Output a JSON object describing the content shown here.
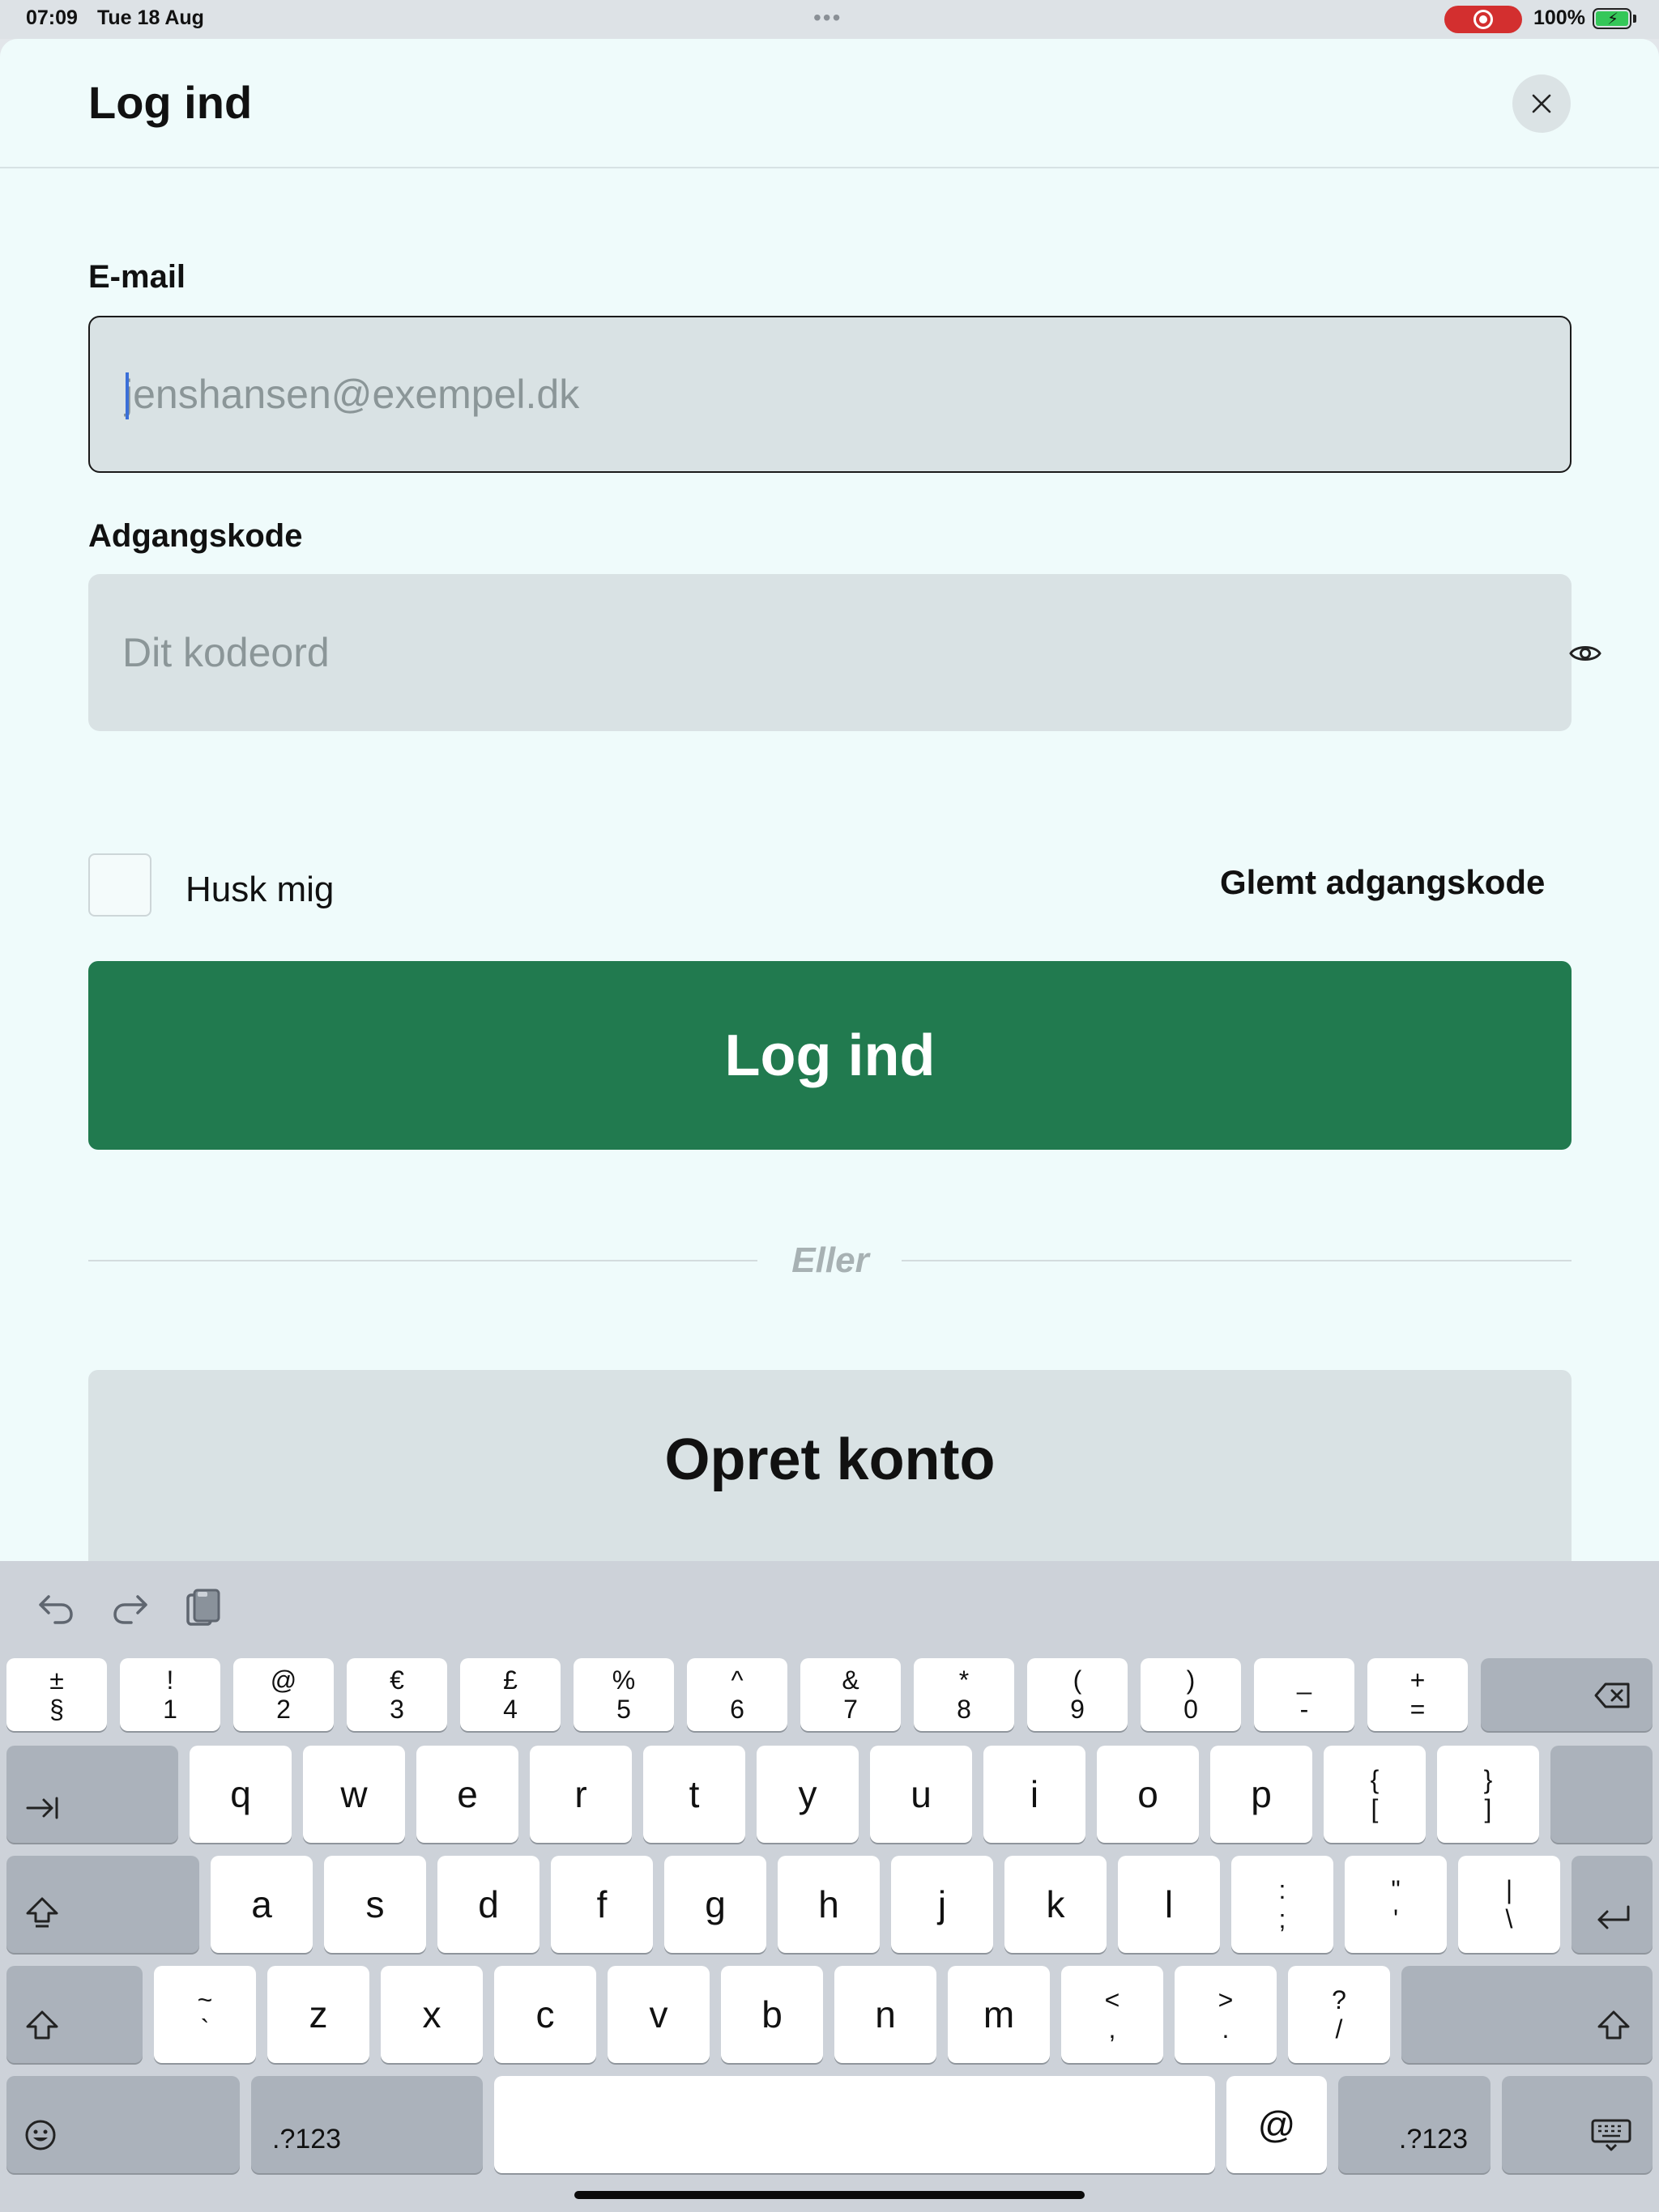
{
  "status_bar": {
    "time": "07:09",
    "date": "Tue 18 Aug",
    "battery_percent": "100%",
    "battery_charging": true,
    "recording_indicator": true
  },
  "sheet": {
    "title": "Log ind",
    "close_icon": "close-icon"
  },
  "form": {
    "email_label": "E-mail",
    "email_placeholder": "jenshansen@exempel.dk",
    "email_value": "",
    "password_label": "Adgangskode",
    "password_placeholder": "Dit kodeord",
    "password_value": "",
    "show_password_icon": "eye-icon",
    "remember_label": "Husk mig",
    "remember_checked": false,
    "forgot_link": "Glemt adgangskode",
    "login_button": "Log ind",
    "divider_text": "Eller",
    "create_account_button": "Opret konto"
  },
  "colors": {
    "primary_green": "#217a4f",
    "sheet_background": "#effbfb",
    "field_background": "#d9e2e4"
  },
  "keyboard": {
    "toolbar_icons": [
      "undo-icon",
      "redo-icon",
      "paste-icon"
    ],
    "number_row": [
      {
        "top": "±",
        "bottom": "§"
      },
      {
        "top": "!",
        "bottom": "1"
      },
      {
        "top": "@",
        "bottom": "2"
      },
      {
        "top": "€",
        "bottom": "3"
      },
      {
        "top": "£",
        "bottom": "4"
      },
      {
        "top": "%",
        "bottom": "5"
      },
      {
        "top": "^",
        "bottom": "6"
      },
      {
        "top": "&",
        "bottom": "7"
      },
      {
        "top": "*",
        "bottom": "8"
      },
      {
        "top": "(",
        "bottom": "9"
      },
      {
        "top": ")",
        "bottom": "0"
      },
      {
        "top": "_",
        "bottom": "-"
      },
      {
        "top": "+",
        "bottom": "="
      }
    ],
    "row_q": [
      "q",
      "w",
      "e",
      "r",
      "t",
      "y",
      "u",
      "i",
      "o",
      "p"
    ],
    "row_q_symbols": [
      {
        "top": "{",
        "bottom": "["
      },
      {
        "top": "}",
        "bottom": "]"
      }
    ],
    "row_a": [
      "a",
      "s",
      "d",
      "f",
      "g",
      "h",
      "j",
      "k",
      "l"
    ],
    "row_a_symbols": [
      {
        "top": ":",
        "bottom": ";"
      },
      {
        "top": "\"",
        "bottom": "'"
      },
      {
        "top": "|",
        "bottom": "\\"
      }
    ],
    "row_z_first": {
      "top": "~",
      "bottom": "`"
    },
    "row_z": [
      "z",
      "x",
      "c",
      "v",
      "b",
      "n",
      "m"
    ],
    "row_z_symbols": [
      {
        "top": "<",
        "bottom": ","
      },
      {
        "top": ">",
        "bottom": "."
      },
      {
        "top": "?",
        "bottom": "/"
      }
    ],
    "numbers_key": ".?123",
    "at_key": "@",
    "bottom_icons": [
      "emoji-icon",
      "keyboard-dismiss-icon"
    ]
  }
}
